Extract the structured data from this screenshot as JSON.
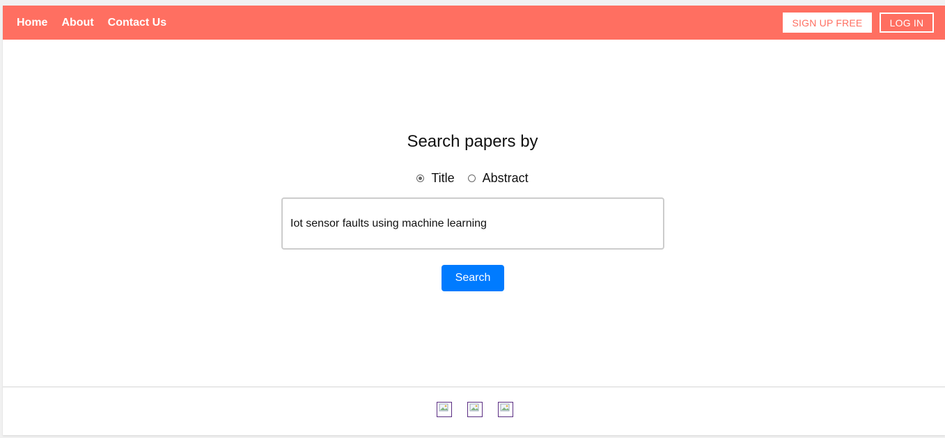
{
  "nav": {
    "links": [
      "Home",
      "About",
      "Contact Us"
    ],
    "signup_label": "SIGN UP FREE",
    "login_label": "LOG IN",
    "bg_color": "#ff6f61"
  },
  "search": {
    "heading": "Search papers by",
    "options": [
      {
        "label": "Title",
        "checked": true
      },
      {
        "label": "Abstract",
        "checked": false
      }
    ],
    "query": "Iot sensor faults using machine learning",
    "button_label": "Search",
    "button_color": "#007bff"
  },
  "footer": {
    "icons": [
      "broken-image-icon",
      "broken-image-icon",
      "broken-image-icon"
    ]
  }
}
